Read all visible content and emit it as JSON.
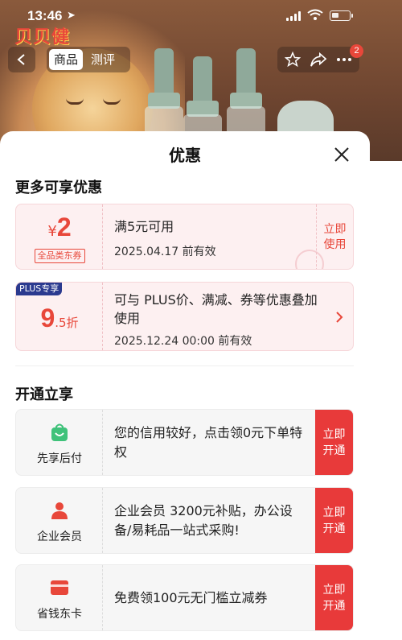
{
  "status_bar": {
    "time": "13:46"
  },
  "brand": {
    "logo": "贝贝健"
  },
  "nav": {
    "tabs": [
      {
        "label": "商品",
        "active": true
      },
      {
        "label": "测评",
        "active": false
      }
    ],
    "cart_badge": "2"
  },
  "sheet": {
    "title": "优惠",
    "more_discounts": {
      "heading": "更多可享优惠",
      "coupons": [
        {
          "currency": "¥",
          "amount": "2",
          "tag": "全品类东券",
          "title": "满5元可用",
          "valid": "2025.04.17 前有效",
          "action": "立即使用"
        },
        {
          "badge": "PLUS专享",
          "amount": "9",
          "amount_suffix": ".5折",
          "title": "可与 PLUS价、满减、券等优惠叠加使用",
          "valid": "2025.12.24 00:00 前有效"
        }
      ]
    },
    "open_now": {
      "heading": "开通立享",
      "items": [
        {
          "icon": "shopping-bag-icon",
          "label": "先享后付",
          "text": "您的信用较好，点击领0元下单特权",
          "action": "立即开通"
        },
        {
          "icon": "user-icon",
          "label": "企业会员",
          "text": "企业会员 3200元补贴，办公设备/易耗品一站式采购!",
          "action": "立即开通"
        },
        {
          "icon": "card-icon",
          "label": "省钱东卡",
          "text": "免费领100元无门槛立减券",
          "action": "立即开通"
        }
      ]
    }
  },
  "colors": {
    "accent": "#e83a3a",
    "coupon_bg": "#fdf0f1",
    "plus_badge": "#2b3a8f"
  }
}
